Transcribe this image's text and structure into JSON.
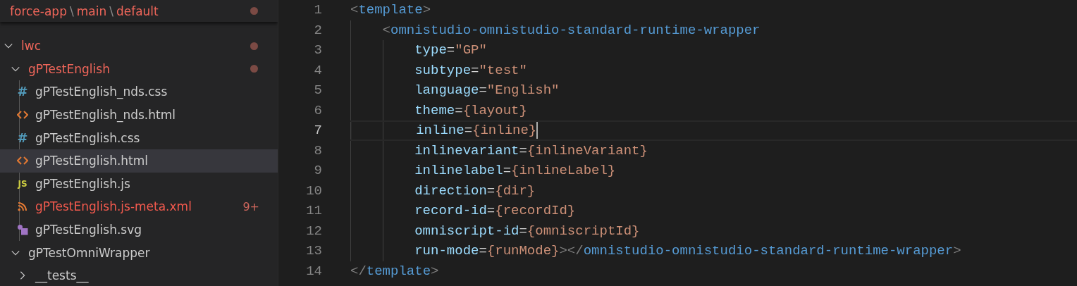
{
  "explorer": {
    "header": {
      "segments": [
        "force-app",
        "main",
        "default"
      ],
      "separator": "\\",
      "modified": true
    },
    "tree": [
      {
        "name": "lwc",
        "kind": "folder",
        "expanded": true,
        "selected": false,
        "modified": true,
        "error": false,
        "children": [
          {
            "name": "gPTestEnglish",
            "kind": "folder",
            "expanded": true,
            "selected": false,
            "modified": true,
            "error": false,
            "children": [
              {
                "name": "gPTestEnglish_nds.css",
                "kind": "css",
                "glyph": "#",
                "selected": false,
                "modified": false,
                "error": false
              },
              {
                "name": "gPTestEnglish_nds.html",
                "kind": "html",
                "selected": false,
                "modified": false,
                "error": false
              },
              {
                "name": "gPTestEnglish.css",
                "kind": "css",
                "glyph": "#",
                "selected": false,
                "modified": false,
                "error": false
              },
              {
                "name": "gPTestEnglish.html",
                "kind": "html",
                "selected": true,
                "modified": false,
                "error": false
              },
              {
                "name": "gPTestEnglish.js",
                "kind": "js",
                "glyph": "JS",
                "selected": false,
                "modified": false,
                "error": false
              },
              {
                "name": "gPTestEnglish.js-meta.xml",
                "kind": "xml",
                "selected": false,
                "modified": false,
                "error": true,
                "badge": "9+"
              },
              {
                "name": "gPTestEnglish.svg",
                "kind": "svg",
                "selected": false,
                "modified": false,
                "error": false
              }
            ]
          },
          {
            "name": "gPTestOmniWrapper",
            "kind": "folder",
            "expanded": true,
            "selected": false,
            "modified": false,
            "error": false,
            "children": [
              {
                "name": "__tests__",
                "kind": "folder",
                "expanded": false,
                "selected": false,
                "modified": false,
                "error": false
              }
            ]
          }
        ]
      }
    ]
  },
  "editor": {
    "lines": [
      {
        "number": "1",
        "current": false,
        "tokens": [
          {
            "text": "<",
            "kind": "punct"
          },
          {
            "text": "template",
            "kind": "tag"
          },
          {
            "text": ">",
            "kind": "punct"
          }
        ]
      },
      {
        "number": "2",
        "current": false,
        "tokens": [
          {
            "text": "    <",
            "kind": "punct"
          },
          {
            "text": "omnistudio-omnistudio-standard-runtime-wrapper",
            "kind": "tag"
          }
        ]
      },
      {
        "number": "3",
        "current": false,
        "tokens": [
          {
            "text": "        type",
            "kind": "attr"
          },
          {
            "text": "=",
            "kind": "op"
          },
          {
            "text": "\"GP\"",
            "kind": "string"
          }
        ]
      },
      {
        "number": "4",
        "current": false,
        "tokens": [
          {
            "text": "        subtype",
            "kind": "attr"
          },
          {
            "text": "=",
            "kind": "op"
          },
          {
            "text": "\"test\"",
            "kind": "string"
          }
        ]
      },
      {
        "number": "5",
        "current": false,
        "tokens": [
          {
            "text": "        language",
            "kind": "attr"
          },
          {
            "text": "=",
            "kind": "op"
          },
          {
            "text": "\"English\"",
            "kind": "string"
          }
        ]
      },
      {
        "number": "6",
        "current": false,
        "tokens": [
          {
            "text": "        theme",
            "kind": "attr"
          },
          {
            "text": "=",
            "kind": "op"
          },
          {
            "text": "{layout}",
            "kind": "string"
          }
        ]
      },
      {
        "number": "7",
        "current": true,
        "tokens": [
          {
            "text": "        inline",
            "kind": "attr"
          },
          {
            "text": "=",
            "kind": "op"
          },
          {
            "text": "{inline}",
            "kind": "string"
          }
        ]
      },
      {
        "number": "8",
        "current": false,
        "tokens": [
          {
            "text": "        inlinevariant",
            "kind": "attr"
          },
          {
            "text": "=",
            "kind": "op"
          },
          {
            "text": "{inlineVariant}",
            "kind": "string"
          }
        ]
      },
      {
        "number": "9",
        "current": false,
        "tokens": [
          {
            "text": "        inlinelabel",
            "kind": "attr"
          },
          {
            "text": "=",
            "kind": "op"
          },
          {
            "text": "{inlineLabel}",
            "kind": "string"
          }
        ]
      },
      {
        "number": "10",
        "current": false,
        "tokens": [
          {
            "text": "        direction",
            "kind": "attr"
          },
          {
            "text": "=",
            "kind": "op"
          },
          {
            "text": "{dir}",
            "kind": "string"
          }
        ]
      },
      {
        "number": "11",
        "current": false,
        "tokens": [
          {
            "text": "        record-id",
            "kind": "attr"
          },
          {
            "text": "=",
            "kind": "op"
          },
          {
            "text": "{recordId}",
            "kind": "string"
          }
        ]
      },
      {
        "number": "12",
        "current": false,
        "tokens": [
          {
            "text": "        omniscript-id",
            "kind": "attr"
          },
          {
            "text": "=",
            "kind": "op"
          },
          {
            "text": "{omniscriptId}",
            "kind": "string"
          }
        ]
      },
      {
        "number": "13",
        "current": false,
        "tokens": [
          {
            "text": "        run-mode",
            "kind": "attr"
          },
          {
            "text": "=",
            "kind": "op"
          },
          {
            "text": "{runMode}",
            "kind": "string"
          },
          {
            "text": "></",
            "kind": "punct"
          },
          {
            "text": "omnistudio-omnistudio-standard-runtime-wrapper",
            "kind": "tag"
          },
          {
            "text": ">",
            "kind": "punct"
          }
        ]
      },
      {
        "number": "14",
        "current": false,
        "tokens": [
          {
            "text": "</",
            "kind": "punct"
          },
          {
            "text": "template",
            "kind": "tag"
          },
          {
            "text": ">",
            "kind": "punct"
          }
        ]
      }
    ]
  }
}
